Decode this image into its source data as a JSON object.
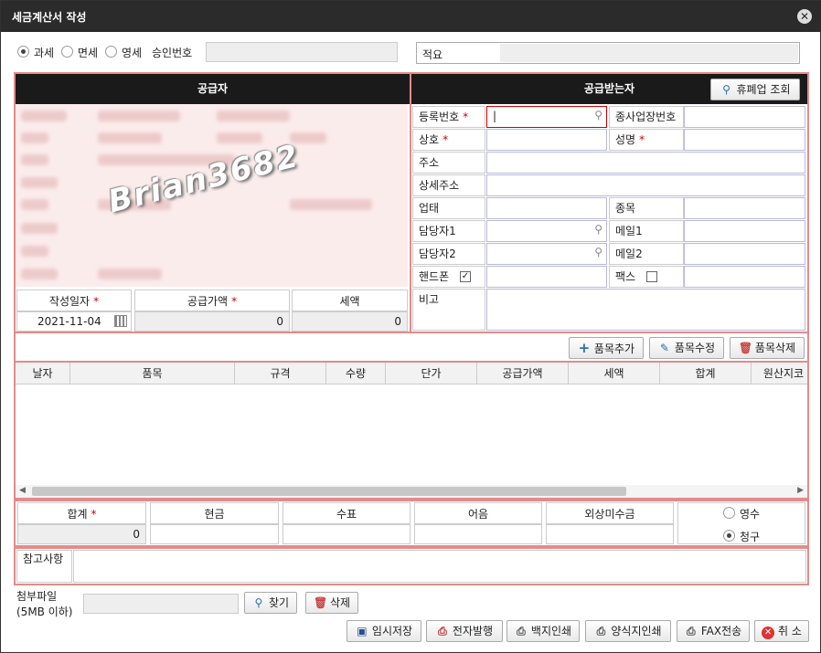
{
  "window": {
    "title": "세금계산서 작성",
    "close": "✕"
  },
  "tax_type": {
    "options": [
      "과세",
      "면세",
      "영세"
    ],
    "selected": "과세",
    "approval_label": "승인번호",
    "approval_value": "",
    "memo_label": "적요",
    "memo_value": ""
  },
  "supplier": {
    "header": "공급자",
    "watermark": "Brian3682",
    "date_label": "작성일자",
    "date_value": "2021-11-04",
    "supply_label": "공급가액",
    "supply_value": "0",
    "tax_label": "세액",
    "tax_value": "0"
  },
  "buyer": {
    "header": "공급받는자",
    "lookup_button": "휴폐업 조회",
    "reg_no_label": "등록번호",
    "reg_no_value": "|",
    "branch_label": "종사업장번호",
    "company_label": "상호",
    "name_label": "성명",
    "address_label": "주소",
    "detail_address_label": "상세주소",
    "business_type_label": "업태",
    "business_item_label": "종목",
    "contact1_label": "담당자1",
    "email1_label": "메일1",
    "contact2_label": "담당자2",
    "email2_label": "메일2",
    "mobile_label": "핸드폰",
    "fax_label": "팩스",
    "note_label": "비고",
    "req_mark": "*"
  },
  "items": {
    "add_button": "품목추가",
    "edit_button": "품목수정",
    "delete_button": "품목삭제",
    "columns": [
      "날자",
      "품목",
      "규격",
      "수량",
      "단가",
      "공급가액",
      "세액",
      "합계",
      "원산지코"
    ]
  },
  "summary": {
    "total_label": "합계",
    "total_value": "0",
    "cash_label": "현금",
    "check_label": "수표",
    "bill_label": "어음",
    "credit_label": "외상미수금",
    "receipt_options": [
      "영수",
      "청구"
    ],
    "receipt_selected": "청구"
  },
  "remarks": {
    "label": "참고사항"
  },
  "attach": {
    "label": "첨부파일",
    "size_note": "(5MB 이하)",
    "find_button": "찾기",
    "delete_button": "삭제"
  },
  "footer": {
    "temp_save": "임시저장",
    "e_issue": "전자발행",
    "blank_print": "백지인쇄",
    "form_print": "양식지인쇄",
    "fax_send": "FAX전송",
    "cancel": "취 소"
  },
  "colors": {
    "title_bg": "#2b2b2b",
    "header_bg": "#1a1a1a",
    "frame": "#e58a8a",
    "required": "#cc0000"
  }
}
